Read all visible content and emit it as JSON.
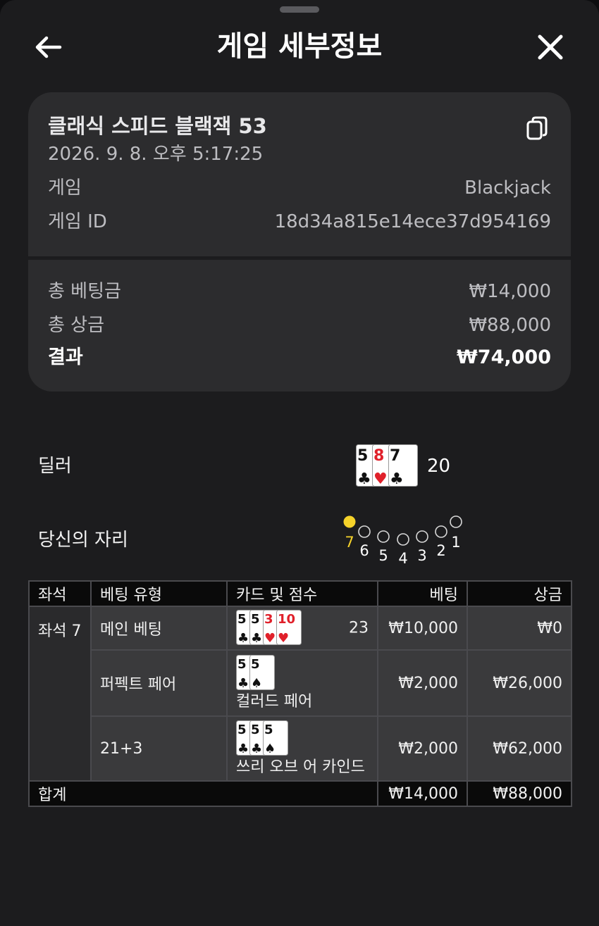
{
  "header": {
    "title": "게임 세부정보",
    "back_icon": "arrow-left-icon",
    "close_icon": "close-icon"
  },
  "summary": {
    "game_name": "클래식 스피드 블랙잭 53",
    "datetime": "2026. 9. 8. 오후 5:17:25",
    "copy_icon": "copy-icon",
    "game_label": "게임",
    "game_value": "Blackjack",
    "game_id_label": "게임 ID",
    "game_id_value": "18d34a815e14ece37d954169",
    "total_bet_label": "총 베팅금",
    "total_bet_value": "₩14,000",
    "total_win_label": "총 상금",
    "total_win_value": "₩88,000",
    "result_label": "결과",
    "result_value": "₩74,000"
  },
  "dealer": {
    "label": "딜러",
    "cards": [
      {
        "rank": "5",
        "suit": "♣",
        "red": false
      },
      {
        "rank": "8",
        "suit": "♥",
        "red": true
      },
      {
        "rank": "7",
        "suit": "♣",
        "red": false
      }
    ],
    "score": "20"
  },
  "seats": {
    "label": "당신의 자리",
    "numbers": [
      "7",
      "6",
      "5",
      "4",
      "3",
      "2",
      "1"
    ],
    "active": "7",
    "active_color": "#f5d22a"
  },
  "table": {
    "headers": {
      "seat": "좌석",
      "bet_type": "베팅 유형",
      "cards": "카드 및 점수",
      "bet": "베팅",
      "win": "상금"
    },
    "seat_name": "좌석 7",
    "rows": [
      {
        "bet_type": "메인 베팅",
        "cards": [
          {
            "rank": "5",
            "suit": "♣",
            "red": false
          },
          {
            "rank": "5",
            "suit": "♣",
            "red": false
          },
          {
            "rank": "3",
            "suit": "♥",
            "red": true
          },
          {
            "rank": "10",
            "suit": "♥",
            "red": true
          }
        ],
        "score": "23",
        "hand_label": "",
        "bet": "₩10,000",
        "win": "₩0"
      },
      {
        "bet_type": "퍼펙트 페어",
        "cards": [
          {
            "rank": "5",
            "suit": "♣",
            "red": false
          },
          {
            "rank": "5",
            "suit": "♠",
            "red": false
          }
        ],
        "score": "",
        "hand_label": "컬러드 페어",
        "bet": "₩2,000",
        "win": "₩26,000"
      },
      {
        "bet_type": "21+3",
        "cards": [
          {
            "rank": "5",
            "suit": "♣",
            "red": false
          },
          {
            "rank": "5",
            "suit": "♣",
            "red": false
          },
          {
            "rank": "5",
            "suit": "♠",
            "red": false
          }
        ],
        "score": "",
        "hand_label": "쓰리 오브 어 카인드",
        "bet": "₩2,000",
        "win": "₩62,000"
      }
    ],
    "total_label": "합계",
    "total_bet": "₩14,000",
    "total_win": "₩88,000"
  }
}
